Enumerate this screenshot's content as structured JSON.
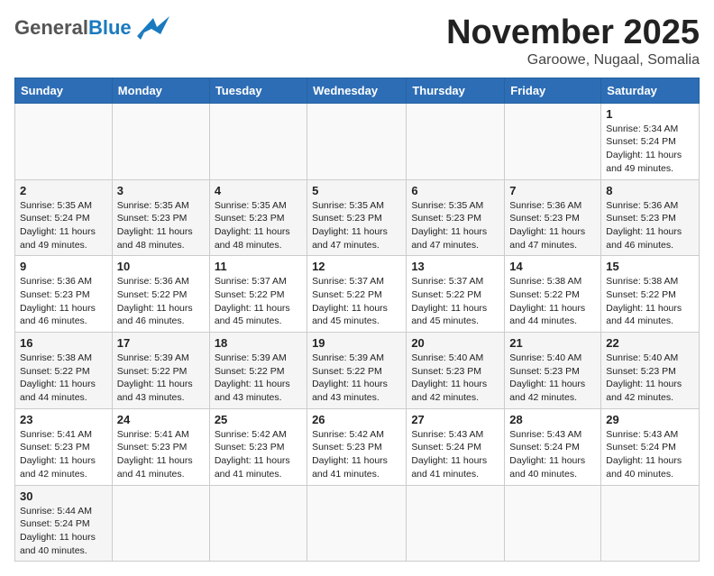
{
  "header": {
    "logo_general": "General",
    "logo_blue": "Blue",
    "month_title": "November 2025",
    "location": "Garoowe, Nugaal, Somalia"
  },
  "weekdays": [
    "Sunday",
    "Monday",
    "Tuesday",
    "Wednesday",
    "Thursday",
    "Friday",
    "Saturday"
  ],
  "days": {
    "1": "Sunrise: 5:34 AM\nSunset: 5:24 PM\nDaylight: 11 hours\nand 49 minutes.",
    "2": "Sunrise: 5:35 AM\nSunset: 5:24 PM\nDaylight: 11 hours\nand 49 minutes.",
    "3": "Sunrise: 5:35 AM\nSunset: 5:23 PM\nDaylight: 11 hours\nand 48 minutes.",
    "4": "Sunrise: 5:35 AM\nSunset: 5:23 PM\nDaylight: 11 hours\nand 48 minutes.",
    "5": "Sunrise: 5:35 AM\nSunset: 5:23 PM\nDaylight: 11 hours\nand 47 minutes.",
    "6": "Sunrise: 5:35 AM\nSunset: 5:23 PM\nDaylight: 11 hours\nand 47 minutes.",
    "7": "Sunrise: 5:36 AM\nSunset: 5:23 PM\nDaylight: 11 hours\nand 47 minutes.",
    "8": "Sunrise: 5:36 AM\nSunset: 5:23 PM\nDaylight: 11 hours\nand 46 minutes.",
    "9": "Sunrise: 5:36 AM\nSunset: 5:23 PM\nDaylight: 11 hours\nand 46 minutes.",
    "10": "Sunrise: 5:36 AM\nSunset: 5:22 PM\nDaylight: 11 hours\nand 46 minutes.",
    "11": "Sunrise: 5:37 AM\nSunset: 5:22 PM\nDaylight: 11 hours\nand 45 minutes.",
    "12": "Sunrise: 5:37 AM\nSunset: 5:22 PM\nDaylight: 11 hours\nand 45 minutes.",
    "13": "Sunrise: 5:37 AM\nSunset: 5:22 PM\nDaylight: 11 hours\nand 45 minutes.",
    "14": "Sunrise: 5:38 AM\nSunset: 5:22 PM\nDaylight: 11 hours\nand 44 minutes.",
    "15": "Sunrise: 5:38 AM\nSunset: 5:22 PM\nDaylight: 11 hours\nand 44 minutes.",
    "16": "Sunrise: 5:38 AM\nSunset: 5:22 PM\nDaylight: 11 hours\nand 44 minutes.",
    "17": "Sunrise: 5:39 AM\nSunset: 5:22 PM\nDaylight: 11 hours\nand 43 minutes.",
    "18": "Sunrise: 5:39 AM\nSunset: 5:22 PM\nDaylight: 11 hours\nand 43 minutes.",
    "19": "Sunrise: 5:39 AM\nSunset: 5:22 PM\nDaylight: 11 hours\nand 43 minutes.",
    "20": "Sunrise: 5:40 AM\nSunset: 5:23 PM\nDaylight: 11 hours\nand 42 minutes.",
    "21": "Sunrise: 5:40 AM\nSunset: 5:23 PM\nDaylight: 11 hours\nand 42 minutes.",
    "22": "Sunrise: 5:40 AM\nSunset: 5:23 PM\nDaylight: 11 hours\nand 42 minutes.",
    "23": "Sunrise: 5:41 AM\nSunset: 5:23 PM\nDaylight: 11 hours\nand 42 minutes.",
    "24": "Sunrise: 5:41 AM\nSunset: 5:23 PM\nDaylight: 11 hours\nand 41 minutes.",
    "25": "Sunrise: 5:42 AM\nSunset: 5:23 PM\nDaylight: 11 hours\nand 41 minutes.",
    "26": "Sunrise: 5:42 AM\nSunset: 5:23 PM\nDaylight: 11 hours\nand 41 minutes.",
    "27": "Sunrise: 5:43 AM\nSunset: 5:24 PM\nDaylight: 11 hours\nand 41 minutes.",
    "28": "Sunrise: 5:43 AM\nSunset: 5:24 PM\nDaylight: 11 hours\nand 40 minutes.",
    "29": "Sunrise: 5:43 AM\nSunset: 5:24 PM\nDaylight: 11 hours\nand 40 minutes.",
    "30": "Sunrise: 5:44 AM\nSunset: 5:24 PM\nDaylight: 11 hours\nand 40 minutes."
  }
}
